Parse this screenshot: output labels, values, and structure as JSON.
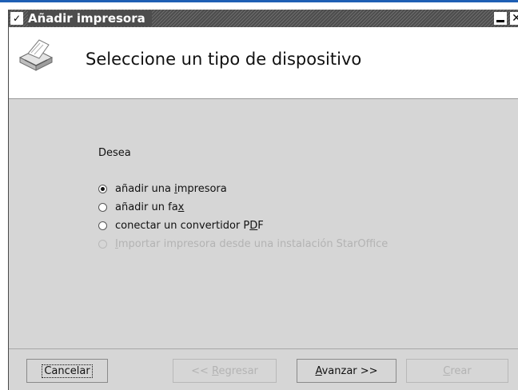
{
  "window": {
    "title": "Añadir impresora",
    "menu_glyph": "✓",
    "close_glyph": "✕"
  },
  "header": {
    "title": "Seleccione un tipo de dispositivo",
    "icon": "printer-icon"
  },
  "content": {
    "question": "Desea",
    "options": [
      {
        "pre": "añadir una ",
        "mnemonic": "i",
        "post": "mpresora",
        "checked": true,
        "enabled": true
      },
      {
        "pre": "añadir un fa",
        "mnemonic": "x",
        "post": "",
        "checked": false,
        "enabled": true
      },
      {
        "pre": "conectar un convertidor P",
        "mnemonic": "D",
        "post": "F",
        "checked": false,
        "enabled": true
      },
      {
        "pre": "",
        "mnemonic": "I",
        "post": "mportar impresora desde una instalación StarOffice",
        "checked": false,
        "enabled": false
      }
    ]
  },
  "buttons": {
    "cancel": {
      "label": "Cancelar",
      "enabled": true
    },
    "back": {
      "pre": "<< ",
      "mnemonic": "R",
      "post": "egresar",
      "enabled": false
    },
    "next": {
      "pre": "",
      "mnemonic": "A",
      "post": "vanzar >>",
      "enabled": true
    },
    "create": {
      "pre": "",
      "mnemonic": "C",
      "post": "rear",
      "enabled": false
    }
  }
}
